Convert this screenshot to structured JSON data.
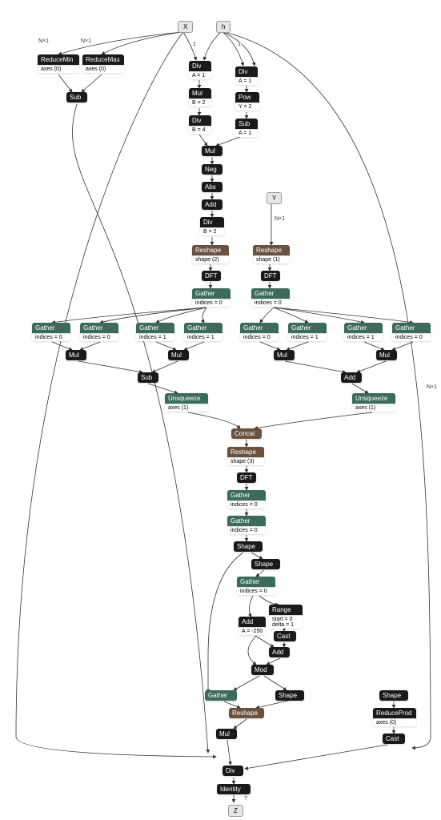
{
  "diagram": {
    "type": "onnx-computation-graph",
    "inputs": [
      "X",
      "h",
      "Y"
    ],
    "outputs": [
      "Z"
    ]
  },
  "io": {
    "X": "X",
    "h": "h",
    "Y": "Y",
    "Z": "Z"
  },
  "labels": {
    "Nx1": "N×1",
    "one": "1",
    "ReduceMin": "ReduceMin",
    "ReduceMax": "ReduceMax",
    "Sub": "Sub",
    "Div": "Div",
    "Mul": "Mul",
    "Pow": "Pow",
    "Neg": "Neg",
    "Abs": "Abs",
    "Add": "Add",
    "Reshape": "Reshape",
    "DFT": "DFT",
    "Gather": "Gather",
    "Unsqueeze": "Unsqueeze",
    "Concat": "Concat",
    "Shape": "Shape",
    "Range": "Range",
    "Cast": "Cast",
    "Mod": "Mod",
    "ReduceProd": "ReduceProd",
    "Identity": "Identity",
    "question": "?"
  },
  "attrs": {
    "axes0": "axes  (0)",
    "axes1": "axes  (1)",
    "A1": "A = 1",
    "B2": "B = 2",
    "B4": "B = 4",
    "Y2": "Y = 2",
    "shape0": "shape  (2)",
    "shape1": "shape  (1)",
    "shape2": "shape  (3)",
    "idx0": "indices = 0",
    "idx1": "indices = 1",
    "A250": "A = -250",
    "range": "start = 0\ndelta = 1"
  }
}
